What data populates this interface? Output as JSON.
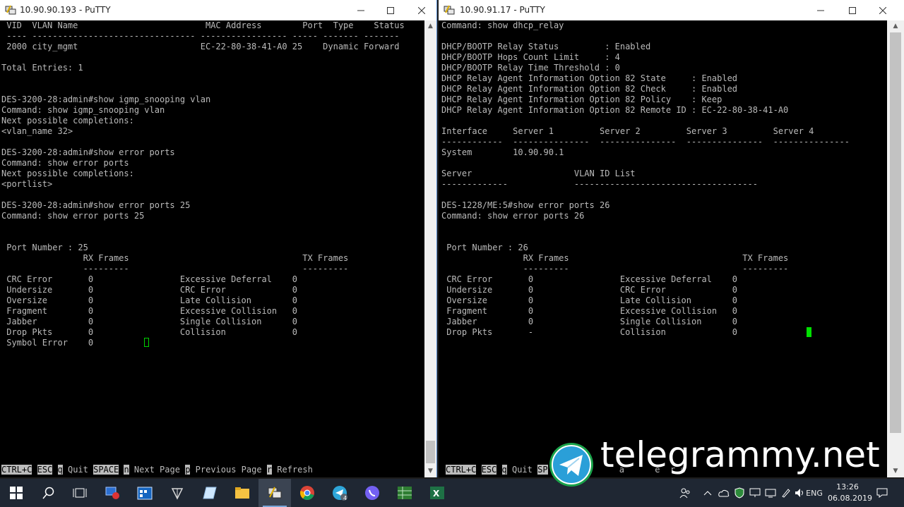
{
  "window_left": {
    "title": "10.90.90.193 - PuTTY",
    "lines": [
      " VID  VLAN Name                         MAC Address        Port  Type    Status",
      " ---- -------------------------------- ----------------- ----- ------- -------",
      " 2000 city_mgmt                        EC-22-80-38-41-A0 25    Dynamic Forward",
      "",
      "Total Entries: 1",
      "",
      "",
      "DES-3200-28:admin#show igmp_snooping vlan",
      "Command: show igmp_snooping vlan",
      "Next possible completions:",
      "<vlan_name 32>",
      "",
      "DES-3200-28:admin#show error ports",
      "Command: show error ports",
      "Next possible completions:",
      "<portlist>",
      "",
      "DES-3200-28:admin#show error ports 25",
      "Command: show error ports 25",
      "",
      "",
      " Port Number : 25",
      "                RX Frames                                  TX Frames",
      "                ---------                                  ---------",
      " CRC Error       0                 Excessive Deferral    0",
      " Undersize       0                 CRC Error             0",
      " Oversize        0                 Late Collision        0",
      " Fragment        0                 Excessive Collision   0",
      " Jabber          0                 Single Collision      0",
      " Drop Pkts       0                 Collision             0",
      " Symbol Error    0"
    ],
    "footer": [
      {
        "text": "CTRL+C",
        "inverse": true
      },
      {
        "text": " ",
        "inverse": false
      },
      {
        "text": "ESC",
        "inverse": true
      },
      {
        "text": " ",
        "inverse": false
      },
      {
        "text": "q",
        "inverse": true
      },
      {
        "text": " Quit ",
        "inverse": false
      },
      {
        "text": "SPACE",
        "inverse": true
      },
      {
        "text": " ",
        "inverse": false
      },
      {
        "text": "n",
        "inverse": true
      },
      {
        "text": " Next Page ",
        "inverse": false
      },
      {
        "text": "p",
        "inverse": true
      },
      {
        "text": " Previous Page ",
        "inverse": false
      },
      {
        "text": "r",
        "inverse": true
      },
      {
        "text": " Refresh",
        "inverse": false
      }
    ]
  },
  "window_right": {
    "title": "10.90.91.17 - PuTTY",
    "lines": [
      "Command: show dhcp_relay",
      "",
      "DHCP/BOOTP Relay Status         : Enabled",
      "DHCP/BOOTP Hops Count Limit     : 4",
      "DHCP/BOOTP Relay Time Threshold : 0",
      "DHCP Relay Agent Information Option 82 State     : Enabled",
      "DHCP Relay Agent Information Option 82 Check     : Enabled",
      "DHCP Relay Agent Information Option 82 Policy    : Keep",
      "DHCP Relay Agent Information Option 82 Remote ID : EC-22-80-38-41-A0",
      "",
      "Interface     Server 1         Server 2         Server 3         Server 4",
      "------------  ---------------  ---------------  ---------------  ---------------",
      "System        10.90.90.1",
      "",
      "Server                    VLAN ID List",
      "-------------             ------------------------------------",
      "",
      "DES-1228/ME:5#show error ports 26",
      "Command: show error ports 26",
      "",
      "",
      " Port Number : 26",
      "                RX Frames                                  TX Frames",
      "                ---------                                  ---------",
      " CRC Error       0                 Excessive Deferral    0",
      " Undersize       0                 CRC Error             0",
      " Oversize        0                 Late Collision        0",
      " Fragment        0                 Excessive Collision   0",
      " Jabber          0                 Single Collision      0",
      " Drop Pkts       -                 Collision             0"
    ],
    "footer": [
      {
        "text": "CTRL+C",
        "inverse": true
      },
      {
        "text": " ",
        "inverse": false
      },
      {
        "text": "ESC",
        "inverse": true
      },
      {
        "text": " ",
        "inverse": false
      },
      {
        "text": "q",
        "inverse": true
      },
      {
        "text": " Quit ",
        "inverse": false
      },
      {
        "text": "SP",
        "inverse": true
      },
      {
        "text": "  ext Pa      a      e  r e",
        "inverse": false
      }
    ]
  },
  "taskbar": {
    "language": "ENG",
    "time": "13:26",
    "date": "06.08.2019",
    "badge_count": "4"
  },
  "watermark": {
    "text": "telegrammy.net"
  },
  "colors": {
    "terminal_bg": "#000000",
    "terminal_fg": "#bbbbbb",
    "cursor": "#00e000",
    "taskbar_bg": "#1f2733"
  }
}
